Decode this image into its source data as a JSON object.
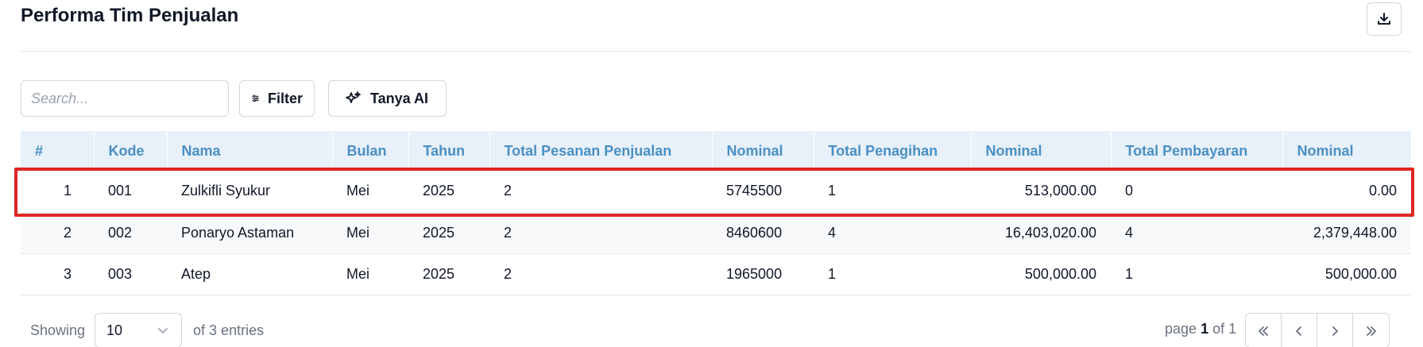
{
  "page": {
    "title": "Performa Tim Penjualan"
  },
  "toolbar": {
    "search_placeholder": "Search...",
    "filter_label": "Filter",
    "ai_label": "Tanya AI"
  },
  "icons": {
    "download": "download-icon",
    "filter": "sliders-icon",
    "ai": "sparkle-icon",
    "dropdown": "chevron-down-icon",
    "first": "chevrons-left-icon",
    "prev": "chevron-left-icon",
    "next": "chevron-right-icon",
    "last": "chevrons-right-icon"
  },
  "table": {
    "headers": [
      "#",
      "Kode",
      "Nama",
      "Bulan",
      "Tahun",
      "Total Pesanan Penjualan",
      "Nominal",
      "Total Penagihan",
      "Nominal",
      "Total Pembayaran",
      "Nominal"
    ],
    "rows": [
      [
        "1",
        "001",
        "Zulkifli Syukur",
        "Mei",
        "2025",
        "2",
        "5745500",
        "1",
        "513,000.00",
        "0",
        "0.00"
      ],
      [
        "2",
        "002",
        "Ponaryo Astaman",
        "Mei",
        "2025",
        "2",
        "8460600",
        "4",
        "16,403,020.00",
        "4",
        "2,379,448.00"
      ],
      [
        "3",
        "003",
        "Atep",
        "Mei",
        "2025",
        "2",
        "1965000",
        "1",
        "500,000.00",
        "1",
        "500,000.00"
      ]
    ]
  },
  "footer": {
    "showing_label": "Showing",
    "page_size": "10",
    "entries_text": "of 3 entries",
    "page_prefix": "page",
    "page_current": "1",
    "page_suffix": "of 1"
  },
  "colors": {
    "header_bg": "#e8f0fa",
    "header_text": "#4a90c4",
    "highlight": "#e02424"
  }
}
